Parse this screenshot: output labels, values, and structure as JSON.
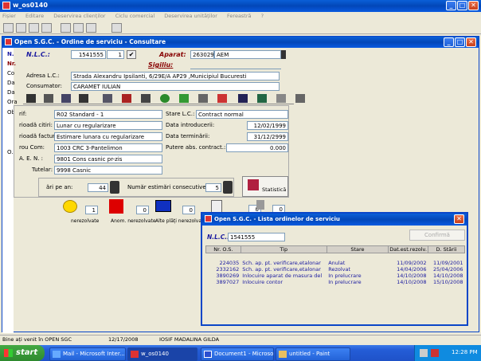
{
  "outer": {
    "title": "w_os0140"
  },
  "menu": [
    "Fișier",
    "Editare",
    "Deservirea clienților",
    "Ciclu comercial",
    "Deservirea unităților",
    "Fereastră",
    "?"
  ],
  "main_window": {
    "title": "Open S.G.C. - Ordine de serviciu - Consultare",
    "nlc_label": "N.L.C.:",
    "nlc_value": "1541555",
    "nlc_suffix": "1",
    "aparat_label": "Aparat:",
    "aparat_value": "263029",
    "aparat_type": "AEM",
    "sigiliu_label": "Sigiliu:",
    "adresa_label": "Adresa L.C.:",
    "adresa_value": "Strada Alexandru Ipsilanti, 6/29E/A AP29 ,Municipiul Bucuresti",
    "consumator_label": "Consumator:",
    "consumator_value": "CARAMET  IULIAN",
    "left_cut": [
      "N.",
      "Nr.",
      "Co",
      "Da",
      "Da",
      "Ora",
      "Ob",
      "O.S"
    ],
    "fields": {
      "tarif_label": "rif:",
      "tarif_value": "R02 Standard - 1",
      "stare_label": "Stare L.C.:",
      "stare_value": "Contract normal",
      "perioada_citiri_label": "rioadă citiri:",
      "perioada_citiri_value": "Lunar cu regularizare",
      "data_intro_label": "Data introducerii:",
      "data_intro_value": "12/02/1999",
      "perioada_fact_label": "rioadă factur.:",
      "perioada_fact_value": "Estimare lunara cu regularizare",
      "data_term_label": "Data terminării:",
      "data_term_value": "31/12/2999",
      "grup_com_label": "rou Com:",
      "grup_com_value": "1003  CRC 3-Pantelimon",
      "putere_label": "Putere abs. contract.:",
      "putere_value": "0.000",
      "caen_label": "A. E. N. :",
      "caen_value": "9801  Cons casnic pr-zis",
      "tutelar_label": "Tutelar:",
      "tutelar_value": "9998  Casnic"
    },
    "estim_label": "ări pe an:",
    "estim_value": "44",
    "consec_label": "Număr estimări consecutive:",
    "consec_value": "5",
    "statistica": "Statistică",
    "bottom": {
      "nerez": "nerezolvate",
      "anom": "Anom. nerezolvate",
      "alte": "Alte plăți nerezolvate",
      "v1": "1",
      "v2": "0",
      "v3": "0",
      "v4": "0",
      "v5": "0"
    }
  },
  "dialog": {
    "title": "Open S.G.C. - Lista ordinelor de serviciu",
    "nlc_label": "N.L.C.:",
    "nlc_value": "1541555",
    "confirm": "Confirmă",
    "columns": [
      "Nr. O.S.",
      "Tip",
      "Stare",
      "Dat.est.rezolv.",
      "D. Stării"
    ],
    "rows": [
      [
        "224035",
        "Sch. ap. pt. verificare,etalonar",
        "Anulat",
        "11/09/2002",
        "11/09/2001"
      ],
      [
        "2332162",
        "Sch. ap. pt. verificare,etalonar",
        "Rezolvat",
        "14/04/2006",
        "25/04/2006"
      ],
      [
        "3890269",
        "Inlocuire aparat de masura del",
        "In prelucrare",
        "14/10/2008",
        "14/10/2008"
      ],
      [
        "3897027",
        "Inlocuire contor",
        "In prelucrare",
        "14/10/2008",
        "15/10/2008"
      ]
    ]
  },
  "status": {
    "msg": "Bine ați venit în OPEN SGC",
    "date": "12/17/2008",
    "user": "IOSIF MADALINA GILDA"
  },
  "taskbar": {
    "start": "start",
    "items": [
      "Mail - Microsoft Inter...",
      "w_os0140",
      "Document1 - Microsof...",
      "untitled - Paint"
    ],
    "clock": "12:28 PM"
  }
}
